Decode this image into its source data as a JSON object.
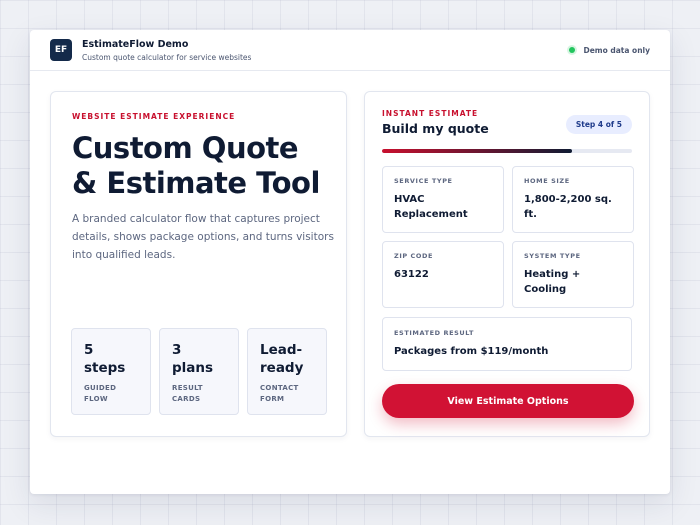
{
  "header": {
    "logo_text": "EF",
    "title": "EstimateFlow Demo",
    "subtitle": "Custom quote calculator for service websites",
    "status_text": "Demo data only",
    "status_color": "#22c55e"
  },
  "hero": {
    "eyebrow": "WEBSITE ESTIMATE EXPERIENCE",
    "headline_line1": "Custom Quote",
    "headline_line2": "& Estimate Tool",
    "description": "A branded calculator flow that captures project details, shows package options, and turns visitors into qualified leads.",
    "stats": [
      {
        "value": "5 steps",
        "label_line1": "GUIDED",
        "label_line2": "FLOW"
      },
      {
        "value": "3 plans",
        "label_line1": "RESULT",
        "label_line2": "CARDS"
      },
      {
        "value": "Lead-ready",
        "label_line1": "CONTACT",
        "label_line2": "FORM"
      }
    ]
  },
  "quote": {
    "eyebrow": "INSTANT ESTIMATE",
    "title": "Build my quote",
    "step_label": "Step 4 of 5",
    "progress": 0.76,
    "fields": [
      {
        "label": "SERVICE TYPE",
        "value": "HVAC Replacement"
      },
      {
        "label": "HOME SIZE",
        "value": "1,800-2,200 sq. ft."
      },
      {
        "label": "ZIP CODE",
        "value": "63122"
      },
      {
        "label": "SYSTEM TYPE",
        "value": "Heating + Cooling"
      }
    ],
    "result_label": "ESTIMATED RESULT",
    "result_value": "Packages from $119/month",
    "cta_label": "View Estimate Options"
  },
  "colors": {
    "accent": "#c8102e",
    "navy": "#0f1b33",
    "cta": "#d11234"
  }
}
